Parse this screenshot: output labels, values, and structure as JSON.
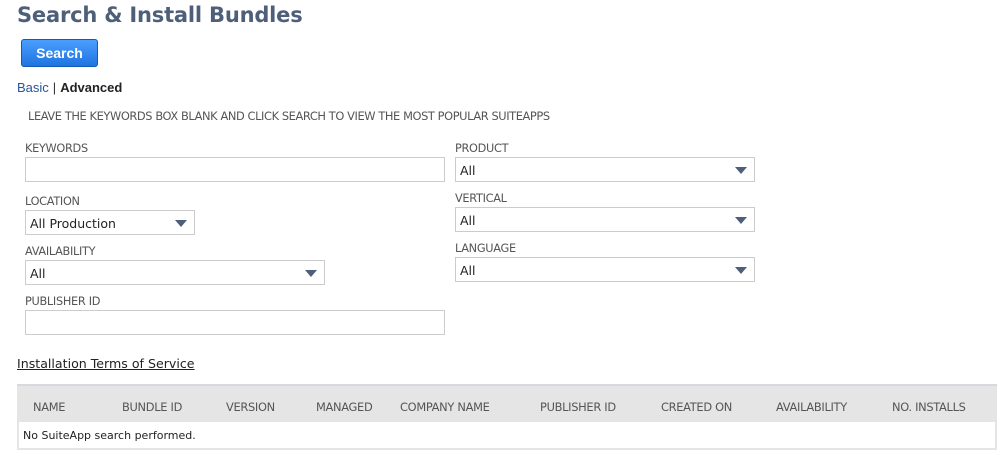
{
  "page": {
    "title": "Search & Install Bundles",
    "search_button": "Search",
    "mode_basic": "Basic",
    "mode_separator": "|",
    "mode_advanced": "Advanced",
    "hint": "LEAVE THE KEYWORDS BOX BLANK AND CLICK SEARCH TO VIEW THE MOST POPULAR SUITEAPPS",
    "tos_link": "Installation Terms of Service"
  },
  "form": {
    "keywords": {
      "label": "KEYWORDS",
      "value": ""
    },
    "location": {
      "label": "LOCATION",
      "value": "All Production"
    },
    "availability": {
      "label": "AVAILABILITY",
      "value": "All"
    },
    "publisher_id": {
      "label": "PUBLISHER ID",
      "value": ""
    },
    "product": {
      "label": "PRODUCT",
      "value": "All"
    },
    "vertical": {
      "label": "VERTICAL",
      "value": "All"
    },
    "language": {
      "label": "LANGUAGE",
      "value": "All"
    }
  },
  "results": {
    "columns": [
      "NAME",
      "BUNDLE ID",
      "VERSION",
      "MANAGED",
      "COMPANY NAME",
      "PUBLISHER ID",
      "CREATED ON",
      "AVAILABILITY",
      "NO. INSTALLS"
    ],
    "empty_message": "No SuiteApp search performed."
  },
  "colors": {
    "title": "#4d5f79",
    "button_top": "#4a9eff",
    "button_bottom": "#1f74e0",
    "link": "#255599",
    "table_header_bg": "#e5e5e5"
  }
}
